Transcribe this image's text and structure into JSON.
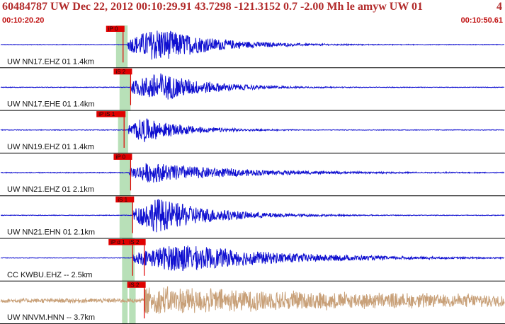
{
  "header": {
    "event_line": "60484787 UW Dec 22, 2012 00:10:29.91    43.7298  -121.3152   0.7  -2.00  Mh  le  amyw  UW  01",
    "event_end": "4",
    "time_start": "00:10:20.20",
    "time_end": "00:10:50.61"
  },
  "colors": {
    "trace": "#1010d0",
    "trace_alt": "#c8a078",
    "pick": "#e00000",
    "window": "#b8e0b8"
  },
  "channels": [
    {
      "label": "UW NN17.EHZ 01 1.4km",
      "color": "trace",
      "picks": [
        {
          "label": "iP 0",
          "t": 0.243
        }
      ],
      "windows": [
        {
          "t0": 0.229,
          "t1": 0.252
        }
      ],
      "onset": 0.252,
      "peak_at": 0.062,
      "amp": 0.85,
      "decay": 9.5,
      "noise": 0.015
    },
    {
      "label": "UW NN17.EHE 01 1.4km",
      "color": "trace",
      "picks": [
        {
          "label": "iS 2",
          "t": 0.258
        }
      ],
      "windows": [
        {
          "t0": 0.236,
          "t1": 0.258
        }
      ],
      "onset": 0.258,
      "peak_at": 0.055,
      "amp": 0.75,
      "decay": 10.5,
      "noise": 0.015
    },
    {
      "label": "UW NN19.EHZ 01 1.4km",
      "color": "trace",
      "picks": [
        {
          "label": "iP iS 1",
          "t": 0.245
        }
      ],
      "windows": [
        {
          "t0": 0.233,
          "t1": 0.253
        }
      ],
      "onset": 0.253,
      "peak_at": 0.03,
      "amp": 0.6,
      "decay": 12,
      "noise": 0.015
    },
    {
      "label": "UW NN21.EHZ 01 2.1km",
      "color": "trace",
      "picks": [
        {
          "label": "iP 0",
          "t": 0.258
        }
      ],
      "windows": [
        {
          "t0": 0.236,
          "t1": 0.258
        }
      ],
      "onset": 0.255,
      "peak_at": 0.04,
      "amp": 0.5,
      "decay": 6,
      "noise": 0.02
    },
    {
      "label": "UW NN21.EHN 01 2.1km",
      "color": "trace",
      "picks": [
        {
          "label": "iS 1",
          "t": 0.262
        }
      ],
      "windows": [
        {
          "t0": 0.236,
          "t1": 0.262
        }
      ],
      "onset": 0.262,
      "peak_at": 0.05,
      "amp": 0.85,
      "decay": 9,
      "noise": 0.015
    },
    {
      "label": "CC KWBU.EHZ -- 2.5km",
      "color": "trace",
      "picks": [
        {
          "label": "iP d 1",
          "t": 0.262
        },
        {
          "label": "iS 2",
          "t": 0.285
        }
      ],
      "windows": [
        {
          "t0": 0.241,
          "t1": 0.266
        }
      ],
      "onset": 0.262,
      "peak_at": 0.09,
      "amp": 0.7,
      "decay": 5,
      "noise": 0.012
    },
    {
      "label": "UW NNVM.HNN -- 3.7km",
      "color": "trace_alt",
      "picks": [
        {
          "label": "iS 2",
          "t": 0.285
        }
      ],
      "windows": [
        {
          "t0": 0.241,
          "t1": 0.252
        },
        {
          "t0": 0.255,
          "t1": 0.268
        }
      ],
      "onset": 0.285,
      "peak_at": 0.02,
      "amp": 0.65,
      "decay": 2.2,
      "noise": 0.1
    }
  ]
}
